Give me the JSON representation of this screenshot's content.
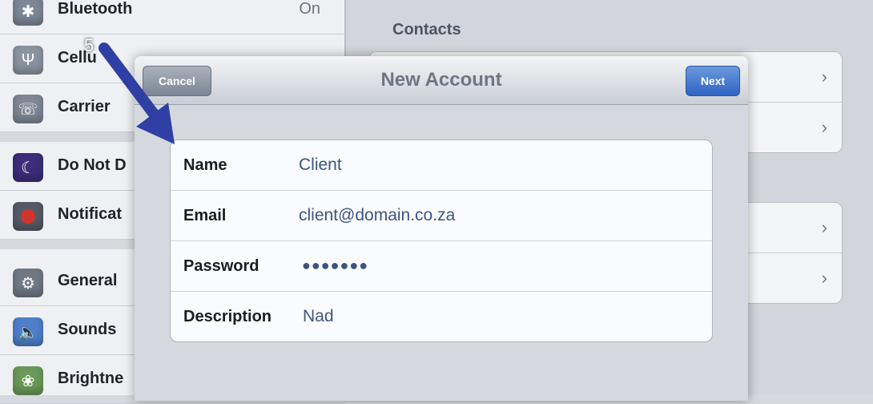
{
  "sidebar": {
    "items": [
      {
        "label": "Bluetooth",
        "value": "On",
        "icon": "bluetooth-icon"
      },
      {
        "label": "Cellu",
        "icon": "cellular-icon"
      },
      {
        "label": "Carrier",
        "icon": "carrier-phone-icon"
      },
      {
        "label": "Do Not D",
        "icon": "do-not-disturb-moon-icon"
      },
      {
        "label": "Notificat",
        "icon": "notifications-icon"
      },
      {
        "label": "General",
        "icon": "general-gear-icon"
      },
      {
        "label": "Sounds",
        "icon": "sounds-speaker-icon"
      },
      {
        "label": "Brightne",
        "icon": "brightness-flower-icon"
      }
    ]
  },
  "right_panel": {
    "heading": "Contacts"
  },
  "modal": {
    "title": "New Account",
    "cancel_label": "Cancel",
    "next_label": "Next",
    "fields": [
      {
        "label": "Name",
        "value": "Client"
      },
      {
        "label": "Email",
        "value": "client@domain.co.za"
      },
      {
        "label": "Password",
        "value": "●●●●●●●"
      },
      {
        "label": "Description",
        "value": "Nad"
      }
    ]
  },
  "annotation": {
    "step_number": "5",
    "arrow_color": "#2f3fa3"
  }
}
